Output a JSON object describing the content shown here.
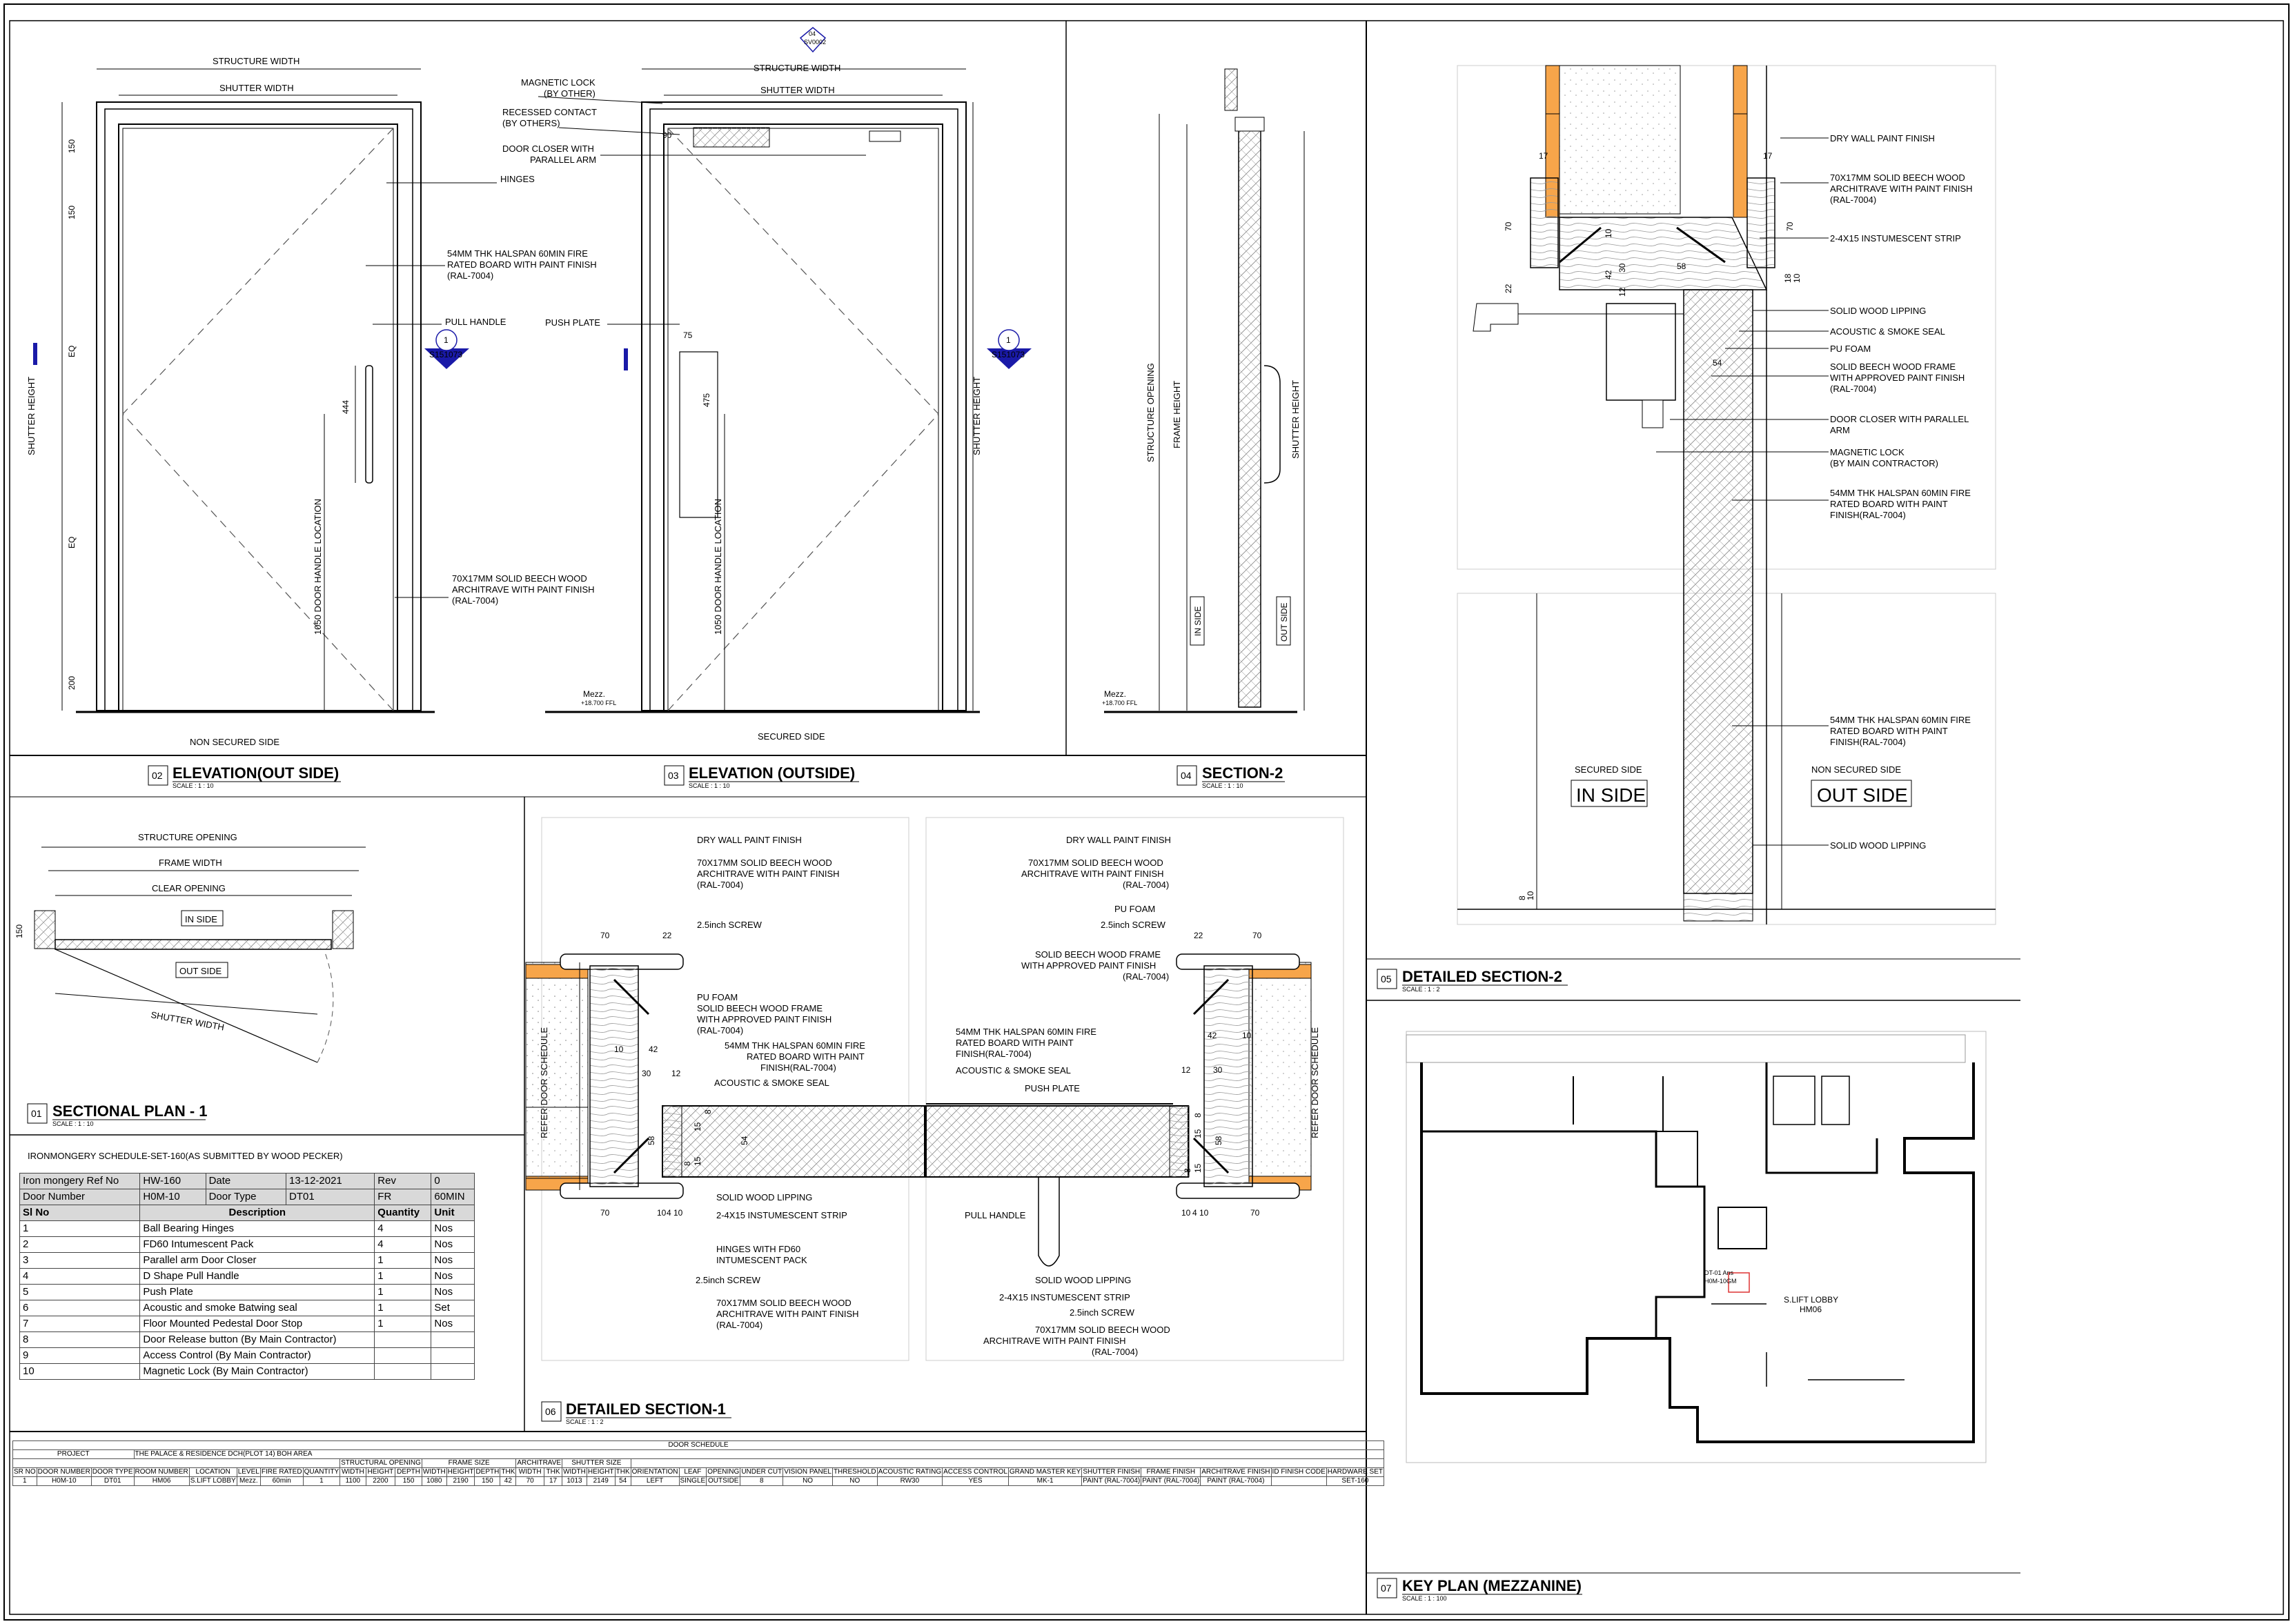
{
  "elevation_out": {
    "title": "ELEVATION(OUT SIDE)",
    "num": "02",
    "scale": "SCALE : 1 : 10",
    "structure_width": "STRUCTURE WIDTH",
    "shutter_width": "SHUTTER WIDTH",
    "hinges": "HINGES",
    "board": [
      "54MM THK HALSPAN 60MIN FIRE",
      "RATED BOARD WITH PAINT FINISH",
      "(RAL-7004)"
    ],
    "pull_handle": "PULL HANDLE",
    "architrave": [
      "70X17MM SOLID BEECH WOOD",
      "ARCHITRAVE WITH PAINT FINISH",
      "(RAL-7004)"
    ],
    "shutter_height": "SHUTTER HEIGHT",
    "handle_loc": "1050 DOOR HANDLE LOCATION",
    "dims": [
      "150",
      "150",
      "EQ",
      "EQ",
      "200",
      "444"
    ],
    "side": "NON SECURED SIDE",
    "tag_num": "1",
    "tag_ref": "S151073"
  },
  "elevation_in": {
    "title": "ELEVATION (OUTSIDE)",
    "num": "03",
    "scale": "SCALE : 1 : 10",
    "structure_width": "STRUCTURE WIDTH",
    "shutter_width": "SHUTTER WIDTH",
    "mag_lock": [
      "MAGNETIC LOCK",
      "(BY OTHER)"
    ],
    "recessed": [
      "RECESSED CONTACT",
      "(BY OTHERS)"
    ],
    "closer": [
      "DOOR CLOSER WITH",
      "PARALLEL ARM"
    ],
    "push_plate": "PUSH  PLATE",
    "shutter_height": "SHUTTER HEIGHT",
    "handle_loc": "1050 DOOR HANDLE LOCATION",
    "dims": [
      "90",
      "75",
      "475"
    ],
    "side": "SECURED SIDE",
    "mezz": "Mezz.",
    "mezz_lvl": "+18.700 FFL",
    "tag_num": "1",
    "tag_ref": "S151073",
    "top_tag": "04",
    "top_tag_sub": "SV0002"
  },
  "section2": {
    "title": "SECTION-2",
    "num": "04",
    "scale": "SCALE : 1 : 10",
    "structure_opening": "STRUCTURE OPENING",
    "frame_height": "FRAME HEIGHT",
    "shutter_height": "SHUTTER HEIGHT",
    "in_side": "IN SIDE",
    "out_side": "OUT SIDE",
    "mezz": "Mezz.",
    "mezz_lvl": "+18.700 FFL"
  },
  "detailed_section2": {
    "title": "DETAILED SECTION-2",
    "num": "05",
    "scale": "SCALE : 1 : 2",
    "labels": [
      [
        "DRY WALL PAINT FINISH"
      ],
      [
        "70X17MM SOLID BEECH WOOD",
        "ARCHITRAVE WITH PAINT FINISH",
        "(RAL-7004)"
      ],
      [
        "2-4X15 INSTUMESCENT STRIP"
      ],
      [
        "SOLID WOOD LIPPING"
      ],
      [
        "ACOUSTIC  & SMOKE SEAL"
      ],
      [
        "PU FOAM"
      ],
      [
        "SOLID  BEECH WOOD FRAME",
        "WITH APPROVED PAINT FINISH",
        "(RAL-7004)"
      ],
      [
        "DOOR CLOSER WITH PARALLEL",
        "ARM"
      ],
      [
        "MAGNETIC LOCK",
        "(BY MAIN CONTRACTOR)"
      ],
      [
        "54MM THK HALSPAN 60MIN FIRE",
        "RATED BOARD WITH PAINT",
        "FINISH(RAL-7004)"
      ]
    ],
    "labels_lower": [
      [
        "54MM THK HALSPAN 60MIN FIRE",
        "RATED BOARD WITH PAINT",
        "FINISH(RAL-7004)"
      ],
      [
        "SOLID WOOD LIPPING"
      ]
    ],
    "dims": [
      "17",
      "17",
      "70",
      "70",
      "22",
      "10",
      "42",
      "30",
      "12",
      "58",
      "54",
      "18",
      "10",
      "8",
      "10"
    ],
    "secured_side": "SECURED SIDE",
    "in_side": "IN SIDE",
    "non_secured": "NON SECURED SIDE",
    "out_side": "OUT SIDE"
  },
  "sectional_plan": {
    "title": "SECTIONAL PLAN - 1",
    "num": "01",
    "scale": "SCALE : 1 : 10",
    "structure_opening": "STRUCTURE OPENING",
    "frame_width": "FRAME WIDTH",
    "clear_opening": "CLEAR OPENING",
    "in_side": "IN SIDE",
    "out_side": "OUT SIDE",
    "shutter_width": "SHUTTER WIDTH",
    "dim": "150"
  },
  "detailed_section1": {
    "title": "DETAILED SECTION-1",
    "num": "06",
    "scale": "SCALE : 1 : 2",
    "left_labels": [
      [
        "DRY WALL PAINT FINISH"
      ],
      [
        "70X17MM SOLID BEECH WOOD",
        "ARCHITRAVE WITH PAINT FINISH",
        "(RAL-7004)"
      ],
      [
        "2.5inch SCREW"
      ],
      [
        "PU FOAM",
        "SOLID BEECH WOOD FRAME",
        "WITH APPROVED PAINT  FINISH",
        "(RAL-7004)"
      ],
      [
        "54MM THK HALSPAN 60MIN FIRE",
        "RATED BOARD WITH PAINT",
        "FINISH(RAL-7004)"
      ],
      [
        "ACOUSTIC & SMOKE SEAL"
      ],
      [
        "SOLID WOOD LIPPING"
      ],
      [
        "2-4X15 INSTUMESCENT STRIP"
      ],
      [
        "HINGES WITH FD60",
        "INTUMESCENT PACK"
      ],
      [
        "2.5inch SCREW"
      ],
      [
        "70X17MM SOLID BEECH WOOD",
        "ARCHITRAVE WITH PAINT FINISH",
        "(RAL-7004)"
      ]
    ],
    "right_labels": [
      [
        "DRY WALL PAINT FINISH"
      ],
      [
        "70X17MM SOLID BEECH WOOD",
        "ARCHITRAVE WITH PAINT FINISH",
        "(RAL-7004)"
      ],
      [
        "PU FOAM"
      ],
      [
        "2.5inch SCREW"
      ],
      [
        "SOLID BEECH WOOD FRAME",
        "WITH APPROVED PAINT  FINISH",
        "(RAL-7004)"
      ],
      [
        "54MM THK HALSPAN 60MIN FIRE",
        "RATED BOARD WITH PAINT",
        "FINISH(RAL-7004)"
      ],
      [
        "ACOUSTIC & SMOKE SEAL"
      ],
      [
        "PUSH PLATE"
      ],
      [
        "PULL HANDLE"
      ],
      [
        "SOLID WOOD LIPPING"
      ],
      [
        "2-4X15 INSTUMESCENT STRIP"
      ],
      [
        "2.5inch SCREW"
      ],
      [
        "70X17MM SOLID BEECH WOOD",
        "ARCHITRAVE WITH PAINT FINISH",
        "(RAL-7004)"
      ]
    ],
    "refer": "REFER DOOR SCHEDULE",
    "dims_left": [
      "70",
      "22",
      "10",
      "42",
      "30",
      "12",
      "58",
      "54",
      "8",
      "15",
      "15",
      "8",
      "70",
      "10",
      "4",
      "10"
    ],
    "dims_right": [
      "22",
      "70",
      "42",
      "10",
      "12",
      "30",
      "58",
      "8",
      "15",
      "15",
      "8",
      "10",
      "4",
      "10",
      "70"
    ]
  },
  "key_plan": {
    "title": "KEY PLAN (MEZZANINE)",
    "num": "07",
    "scale": "SCALE : 1 : 100",
    "room": "S.LIFT LOBBY",
    "room_code": "HM06",
    "door_tag": [
      "DT-01 Ans",
      "H0M-10GM"
    ]
  },
  "ironmongery": {
    "title": "IRONMONGERY SCHEDULE-SET-160(AS SUBMITTED BY WOOD PECKER)",
    "ref_label": "Iron mongery Ref No",
    "ref_value": "HW-160",
    "date_label": "Date",
    "date_value": "13-12-2021",
    "rev_label": "Rev",
    "rev_value": "0",
    "door_label": "Door Number",
    "door_value": "H0M-10",
    "type_label": "Door Type",
    "type_value": "DT01",
    "fr_label": "FR",
    "fr_value": "60MIN",
    "columns": [
      "Sl No",
      "Description",
      "Quantity",
      "Unit"
    ],
    "rows": [
      [
        "1",
        "Ball Bearing Hinges",
        "4",
        "Nos"
      ],
      [
        "2",
        "FD60 Intumescent Pack",
        "4",
        "Nos"
      ],
      [
        "3",
        "Parallel arm Door Closer",
        "1",
        "Nos"
      ],
      [
        "4",
        "D Shape Pull Handle",
        "1",
        "Nos"
      ],
      [
        "5",
        "Push Plate",
        "1",
        "Nos"
      ],
      [
        "6",
        "Acoustic and smoke Batwing seal",
        "1",
        "Set"
      ],
      [
        "7",
        "Floor Mounted Pedestal Door Stop",
        "1",
        "Nos"
      ],
      [
        "8",
        "Door Release button (By Main Contractor)",
        "",
        ""
      ],
      [
        "9",
        "Access Control (By Main Contractor)",
        "",
        ""
      ],
      [
        "10",
        "Magnetic Lock (By Main Contractor)",
        "",
        ""
      ]
    ]
  },
  "door_schedule": {
    "title": "DOOR SCHEDULE",
    "project_label": "PROJECT",
    "project_value": "THE  PALACE & RESIDENCE DCH(PLOT 14) BOH AREA",
    "group_headers": {
      "structural": "STRUCTURAL OPENING",
      "frame": "FRAME SIZE",
      "architrave": "ARCHITRAVE",
      "shutter": "SHUTTER SIZE"
    },
    "headers": [
      "SR NO",
      "DOOR NUMBER",
      "DOOR TYPE",
      "ROOM NUMBER",
      "LOCATION",
      "LEVEL",
      "FIRE RATED",
      "QUANTITY",
      "WIDTH",
      "HEIGHT",
      "DEPTH",
      "WIDTH",
      "HEIGHT",
      "DEPTH",
      "THK",
      "WIDTH",
      "THK",
      "WIDTH",
      "HEIGHT",
      "THK",
      "ORIENTATION",
      "LEAF",
      "OPENING",
      "UNDER CUT",
      "VISION PANEL",
      "THRESHOLD",
      "ACOUSTIC RATING",
      "ACCESS CONTROL",
      "GRAND MASTER KEY",
      "SHUTTER FINISH",
      "FRAME FINISH",
      "ARCHITRAVE FINISH",
      "ID FINISH CODE",
      "HARDWARE SET"
    ],
    "row": [
      "1",
      "H0M-10",
      "DT01",
      "HM06",
      "S.LIFT LOBBY",
      "Mezz.",
      "60min",
      "1",
      "1100",
      "2200",
      "150",
      "1080",
      "2190",
      "150",
      "42",
      "70",
      "17",
      "1013",
      "2149",
      "54",
      "LEFT",
      "SINGLE",
      "OUTSIDE",
      "8",
      "NO",
      "NO",
      "RW30",
      "YES",
      "MK-1",
      "PAINT (RAL-7004)",
      "PAINT (RAL-7004)",
      "PAINT (RAL-7004)",
      "",
      "SET-160"
    ]
  }
}
